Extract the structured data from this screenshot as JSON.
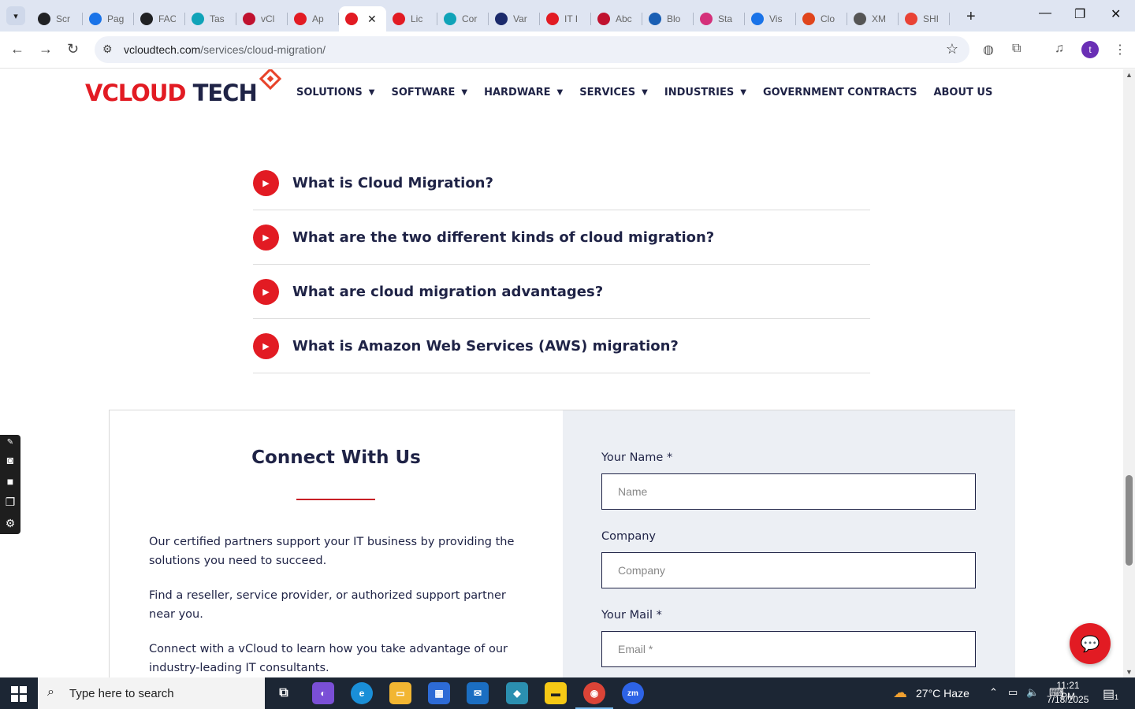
{
  "browser": {
    "tabs": [
      {
        "title": "Scr",
        "icon_color": "#202124",
        "icon": "camera-icon"
      },
      {
        "title": "Pag",
        "icon_color": "#1a73e8",
        "icon": "speed-icon"
      },
      {
        "title": "FAC",
        "icon_color": "#202124",
        "icon": "chatgpt-icon"
      },
      {
        "title": "Tas",
        "icon_color": "#10a3b8",
        "icon": "hex-icon"
      },
      {
        "title": "vCl",
        "icon_color": "#c0122f",
        "icon": "v-icon"
      },
      {
        "title": "Ap",
        "icon_color": "#e21b23",
        "icon": "vcloud-icon"
      },
      {
        "title": "",
        "icon_color": "#e21b23",
        "icon": "vcloud-icon",
        "active": true
      },
      {
        "title": "Lic",
        "icon_color": "#e21b23",
        "icon": "vcloud-icon"
      },
      {
        "title": "Cor",
        "icon_color": "#10a3b8",
        "icon": "hex-icon"
      },
      {
        "title": "Var",
        "icon_color": "#1b2a6b",
        "icon": "x-icon"
      },
      {
        "title": "IT I",
        "icon_color": "#e21b23",
        "icon": "vcloud-icon"
      },
      {
        "title": "Abc",
        "icon_color": "#c0122f",
        "icon": "brand-icon"
      },
      {
        "title": "Blo",
        "icon_color": "#1a5fb4",
        "icon": "scale-icon"
      },
      {
        "title": "Sta",
        "icon_color": "#d4307a",
        "icon": "pen-icon"
      },
      {
        "title": "Vis",
        "icon_color": "#1a73e8",
        "icon": "pulse-icon"
      },
      {
        "title": "Clo",
        "icon_color": "#e0451c",
        "icon": "slash-icon"
      },
      {
        "title": "XM",
        "icon_color": "#555555",
        "icon": "globe-icon"
      },
      {
        "title": "SHI",
        "icon_color": "#e94235",
        "icon": "ring-icon"
      }
    ],
    "url_domain": "vcloudtech.com",
    "url_path": "/services/cloud-migration/",
    "profile_initial": "t"
  },
  "site": {
    "logo_v": "V",
    "logo_cloud": "CLOUD",
    "logo_tech": " TECH",
    "nav": [
      {
        "label": "SOLUTIONS",
        "dropdown": true
      },
      {
        "label": "SOFTWARE",
        "dropdown": true
      },
      {
        "label": "HARDWARE",
        "dropdown": true
      },
      {
        "label": "SERVICES",
        "dropdown": true
      },
      {
        "label": "INDUSTRIES",
        "dropdown": true
      },
      {
        "label": "GOVERNMENT CONTRACTS",
        "dropdown": false
      },
      {
        "label": "ABOUT US",
        "dropdown": false
      }
    ]
  },
  "faq": [
    "What is Cloud Migration?",
    "What are the two different kinds of cloud migration?",
    "What are cloud migration advantages?",
    "What is Amazon Web Services (AWS) migration?"
  ],
  "connect": {
    "title": "Connect With Us",
    "paragraphs": [
      "Our certified partners support your IT business by providing the solutions you need to succeed.",
      "Find a reseller, service provider, or authorized support partner near you.",
      "Connect with a vCloud to learn how you take advantage of our industry-leading IT consultants."
    ],
    "fields": [
      {
        "label": "Your Name *",
        "placeholder": "Name"
      },
      {
        "label": "Company",
        "placeholder": "Company"
      },
      {
        "label": "Your Mail *",
        "placeholder": "Email *"
      }
    ]
  },
  "taskbar": {
    "search_placeholder": "Type here to search",
    "weather": "27°C  Haze",
    "time": "11:21 PM",
    "date": "7/18/2025",
    "notifications": "1"
  },
  "colors": {
    "brand_red": "#e21b23",
    "navy": "#1f2346",
    "form_bg": "#eceff4"
  }
}
